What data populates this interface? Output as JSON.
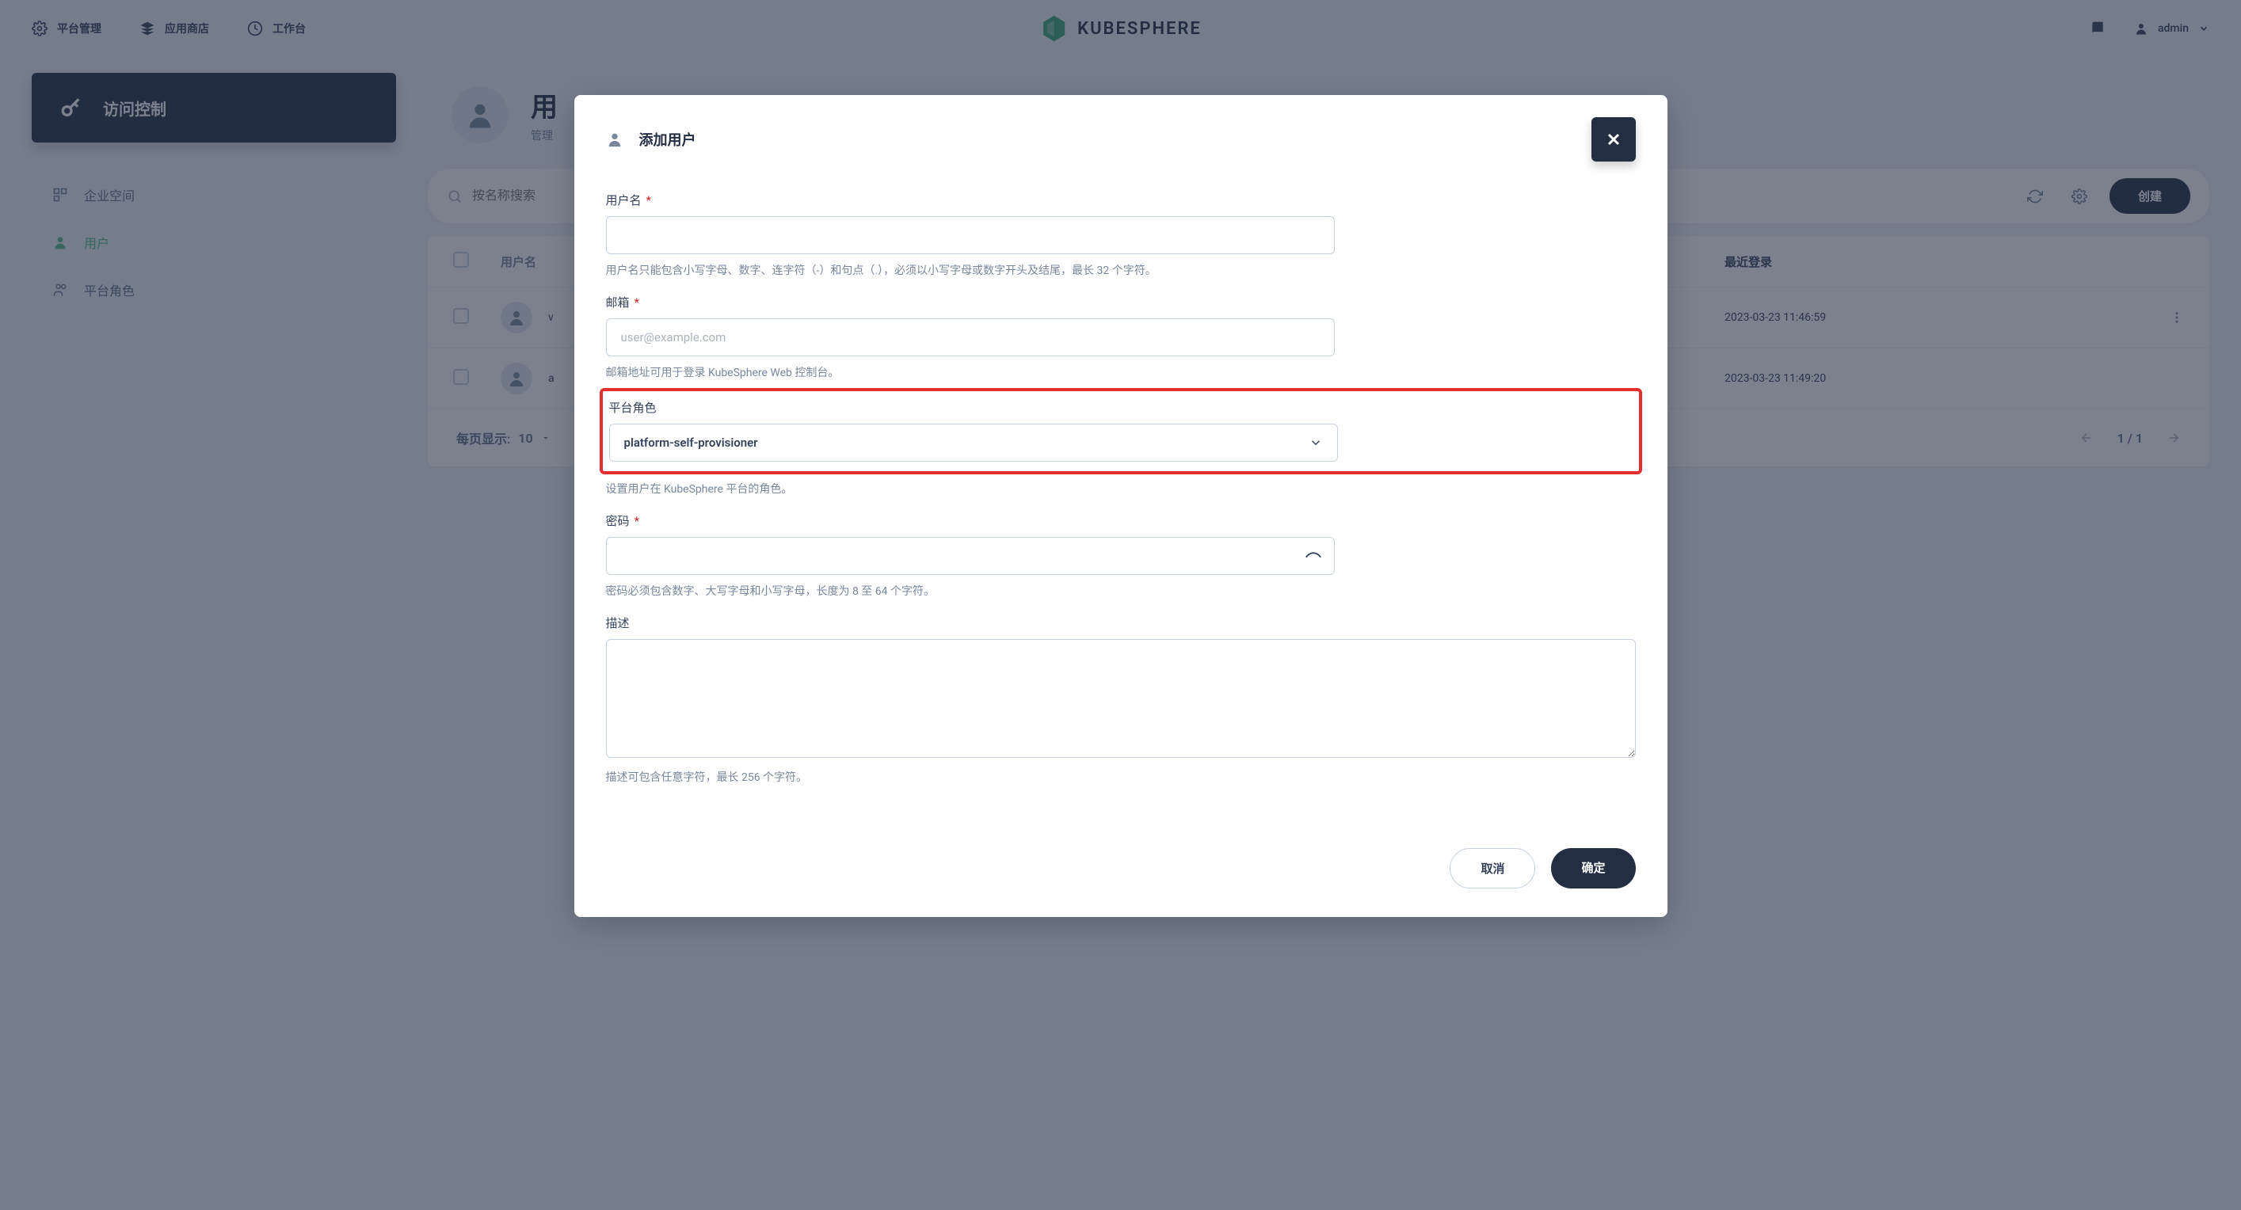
{
  "topnav": {
    "platform": "平台管理",
    "appstore": "应用商店",
    "workbench": "工作台",
    "logo": "KUBESPHERE",
    "user": "admin"
  },
  "sidebar": {
    "title": "访问控制",
    "items": [
      {
        "label": "企业空间"
      },
      {
        "label": "用户"
      },
      {
        "label": "平台角色"
      }
    ]
  },
  "page": {
    "title": "用",
    "sub": "管理"
  },
  "toolbar": {
    "search_placeholder": "按名称搜索",
    "create": "创建"
  },
  "table": {
    "headers": {
      "name": "用户名",
      "last_login": "最近登录"
    },
    "rows": [
      {
        "name": "v",
        "last_login": "2023-03-23 11:46:59"
      },
      {
        "name": "a",
        "last_login": "2023-03-23 11:49:20"
      }
    ],
    "footer": {
      "per_page_label": "每页显示:",
      "per_page_value": "10",
      "page_info": "1 / 1"
    }
  },
  "modal": {
    "title": "添加用户",
    "fields": {
      "username": {
        "label": "用户名",
        "hint": "用户名只能包含小写字母、数字、连字符（-）和句点（.），必须以小写字母或数字开头及结尾，最长 32 个字符。"
      },
      "email": {
        "label": "邮箱",
        "placeholder": "user@example.com",
        "hint": "邮箱地址可用于登录 KubeSphere Web 控制台。"
      },
      "role": {
        "label": "平台角色",
        "value": "platform-self-provisioner",
        "hint": "设置用户在 KubeSphere 平台的角色。"
      },
      "password": {
        "label": "密码",
        "hint": "密码必须包含数字、大写字母和小写字母，长度为 8 至 64 个字符。"
      },
      "description": {
        "label": "描述",
        "hint": "描述可包含任意字符，最长 256 个字符。"
      }
    },
    "buttons": {
      "cancel": "取消",
      "ok": "确定"
    }
  }
}
